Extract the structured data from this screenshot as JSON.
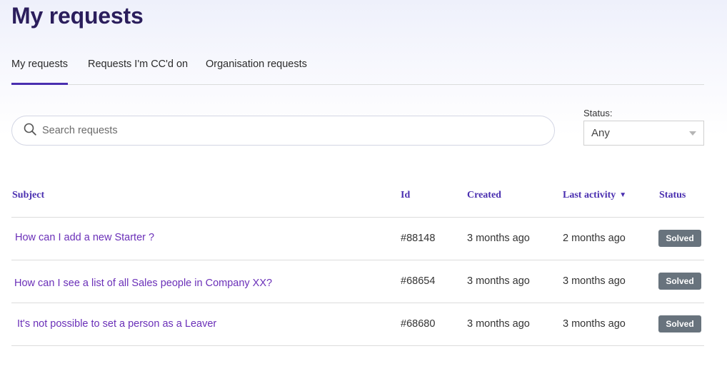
{
  "page": {
    "title": "My requests"
  },
  "tabs": [
    {
      "label": "My requests",
      "active": true
    },
    {
      "label": "Requests I'm CC'd on",
      "active": false
    },
    {
      "label": "Organisation requests",
      "active": false
    }
  ],
  "search": {
    "placeholder": "Search requests",
    "value": "",
    "icon": "search-icon"
  },
  "status_filter": {
    "label": "Status:",
    "selected": "Any",
    "icon": "chevron-down-icon"
  },
  "table": {
    "headers": {
      "subject": "Subject",
      "id": "Id",
      "created": "Created",
      "last_activity": "Last activity",
      "status": "Status"
    },
    "sort": {
      "column": "last_activity",
      "indicator": "▼"
    },
    "rows": [
      {
        "subject": "How can I add a new Starter ?",
        "id": "#88148",
        "created": "3 months ago",
        "last_activity": "2 months ago",
        "status": "Solved"
      },
      {
        "subject": "How can I see a list of all Sales people in Company XX?",
        "id": "#68654",
        "created": "3 months ago",
        "last_activity": "3 months ago",
        "status": "Solved"
      },
      {
        "subject": "It's not possible to set a person as a Leaver",
        "id": "#68680",
        "created": "3 months ago",
        "last_activity": "3 months ago",
        "status": "Solved"
      }
    ]
  },
  "colors": {
    "title": "#2b1e5c",
    "accent": "#4a2fb0",
    "link": "#6a2fb8",
    "badge_solved": "#68737d"
  }
}
